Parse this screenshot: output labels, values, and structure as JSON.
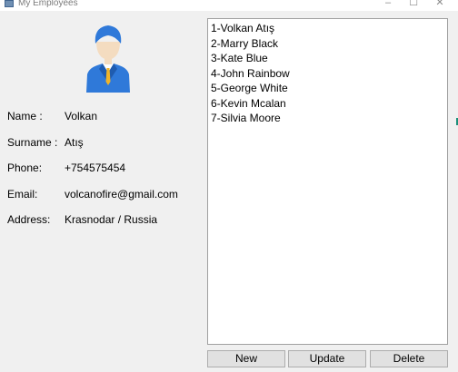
{
  "window": {
    "title": "My Employees",
    "controls": {
      "minimize": "–",
      "maximize": "☐",
      "close": "✕"
    }
  },
  "avatar": {
    "icon": "employee-avatar-icon"
  },
  "details": {
    "name": {
      "label": "Name :",
      "value": "Volkan"
    },
    "surname": {
      "label": "Surname :",
      "value": "Atış"
    },
    "phone": {
      "label": "Phone:",
      "value": "+754575454"
    },
    "email": {
      "label": "Email:",
      "value": "volcanofire@gmail.com"
    },
    "address": {
      "label": "Address:",
      "value": "Krasnodar / Russia"
    }
  },
  "employees": [
    "1-Volkan Atış",
    "2-Marry Black",
    "3-Kate Blue",
    "4-John Rainbow",
    "5-George White",
    "6-Kevin Mcalan",
    "7-Silvia Moore"
  ],
  "buttons": {
    "new": "New",
    "update": "Update",
    "delete": "Delete"
  },
  "colors": {
    "window_bg": "#f0f0f0",
    "avatar_blue": "#2f79d9",
    "avatar_dark_blue": "#1f5cb0",
    "tie_gold": "#f0b429",
    "skin": "#f4dcc0",
    "button_bg": "#e1e1e1"
  }
}
